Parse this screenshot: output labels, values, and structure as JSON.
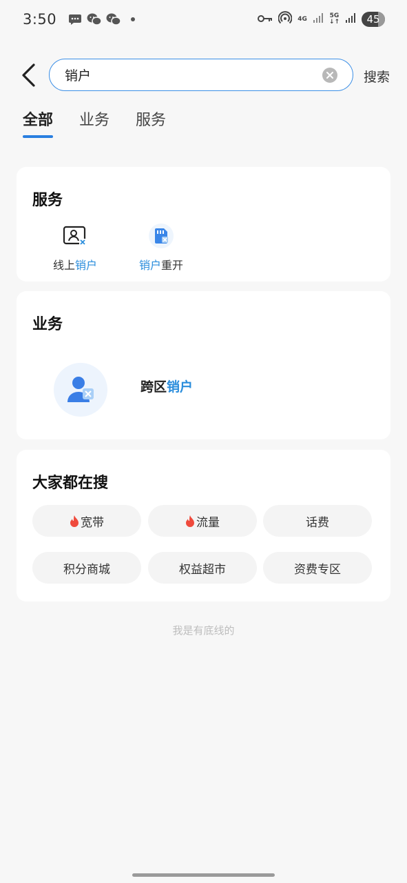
{
  "status_bar": {
    "time": "3:50",
    "network_1": "4G",
    "network_2": "5G",
    "battery": "45"
  },
  "search": {
    "query": "销户",
    "placeholder": "",
    "submit_label": "搜索"
  },
  "tabs": [
    {
      "label": "全部",
      "active": true
    },
    {
      "label": "业务",
      "active": false
    },
    {
      "label": "服务",
      "active": false
    }
  ],
  "service_section": {
    "title": "服务",
    "items": [
      {
        "prefix": "线上",
        "highlight": "销户",
        "suffix": ""
      },
      {
        "prefix": "",
        "highlight": "销户",
        "suffix": "重开"
      }
    ]
  },
  "business_section": {
    "title": "业务",
    "item": {
      "prefix": "跨区",
      "highlight": "销户"
    }
  },
  "hot_section": {
    "title": "大家都在搜",
    "chips": [
      {
        "label": "宽带",
        "hot": true
      },
      {
        "label": "流量",
        "hot": true
      },
      {
        "label": "话费",
        "hot": false
      },
      {
        "label": "积分商城",
        "hot": false
      },
      {
        "label": "权益超市",
        "hot": false
      },
      {
        "label": "资费专区",
        "hot": false
      }
    ]
  },
  "footer": {
    "bottom_text": "我是有底线的"
  },
  "colors": {
    "accent": "#2a7fe0",
    "highlight": "#2a8ddc",
    "background": "#f7f7f7"
  }
}
